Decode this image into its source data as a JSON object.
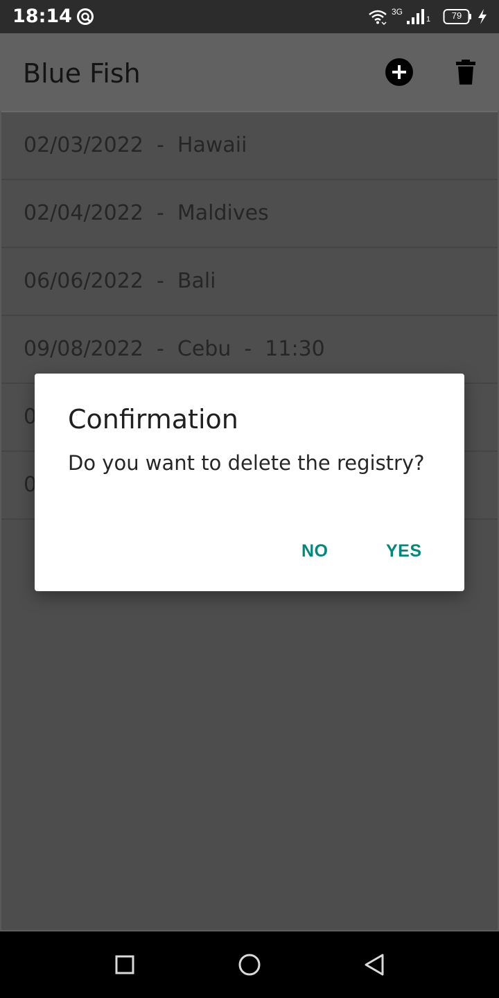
{
  "status_bar": {
    "time": "18:14",
    "network_type": "3G",
    "sim_slot": "1",
    "battery_level": "79",
    "icons": [
      "sync-icon",
      "wifi-icon",
      "signal-icon",
      "battery-icon",
      "charging-icon"
    ]
  },
  "app_bar": {
    "title": "Blue Fish",
    "actions": [
      "add-icon",
      "delete-icon"
    ]
  },
  "list": {
    "items": [
      {
        "label": "02/03/2022  -  Hawaii"
      },
      {
        "label": "02/04/2022  -  Maldives"
      },
      {
        "label": "06/06/2022  -  Bali"
      },
      {
        "label": "09/08/2022  -  Cebu  -  11:30"
      },
      {
        "label": "0"
      },
      {
        "label": "0"
      }
    ]
  },
  "dialog": {
    "title": "Confirmation",
    "message": "Do you want to delete the registry?",
    "negative_label": "NO",
    "positive_label": "YES",
    "accent_color": "#00897b"
  },
  "nav_bar": {
    "buttons": [
      "recents-icon",
      "home-icon",
      "back-icon"
    ]
  }
}
